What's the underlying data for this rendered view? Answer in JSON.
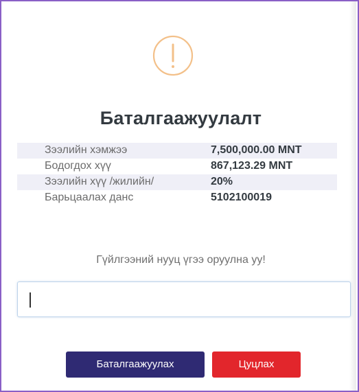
{
  "dialog": {
    "title": "Баталгаажуулалт",
    "icon": "exclamation-circle-icon",
    "accent_color": "#f3c089"
  },
  "details": [
    {
      "label": "Зээлийн хэмжээ",
      "value": "7,500,000.00 MNT"
    },
    {
      "label": "Бодогдох хүү",
      "value": "867,123.29 MNT"
    },
    {
      "label": "Зээлийн хүү /жилийн/",
      "value": "20%"
    },
    {
      "label": "Барьцаалах данс",
      "value": "5102100019"
    }
  ],
  "password": {
    "prompt": "Гүйлгээний нууц үгээ оруулна уу!",
    "value": ""
  },
  "buttons": {
    "confirm_label": "Баталгаажуулах",
    "confirm_color": "#2f2a73",
    "cancel_label": "Цуцлах",
    "cancel_color": "#e2262c"
  }
}
